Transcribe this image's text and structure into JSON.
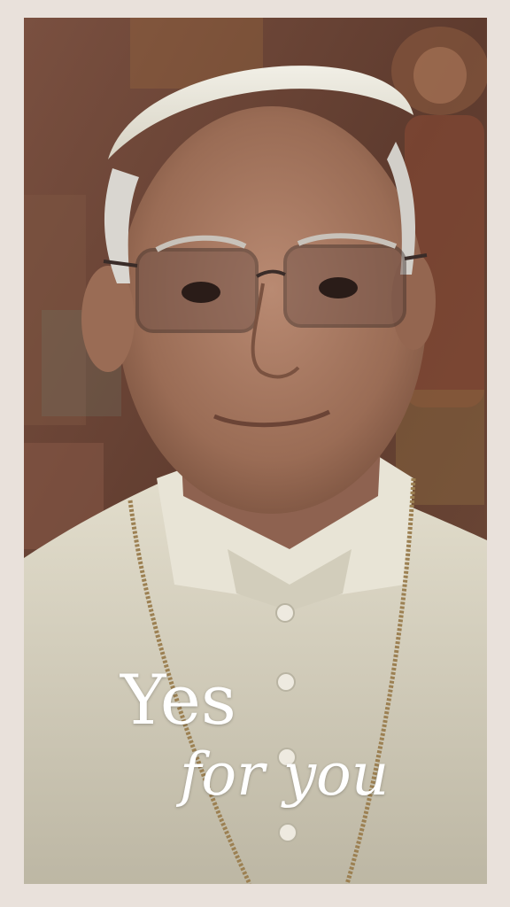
{
  "caption": {
    "line1": "Yes",
    "line2": "for you"
  },
  "colors": {
    "frame": "#e9e1db",
    "text": "#ffffff",
    "background_mural": "#6b4535",
    "cassock": "#dcd8c8"
  },
  "subject": {
    "description_icon": "portrait-photo"
  }
}
